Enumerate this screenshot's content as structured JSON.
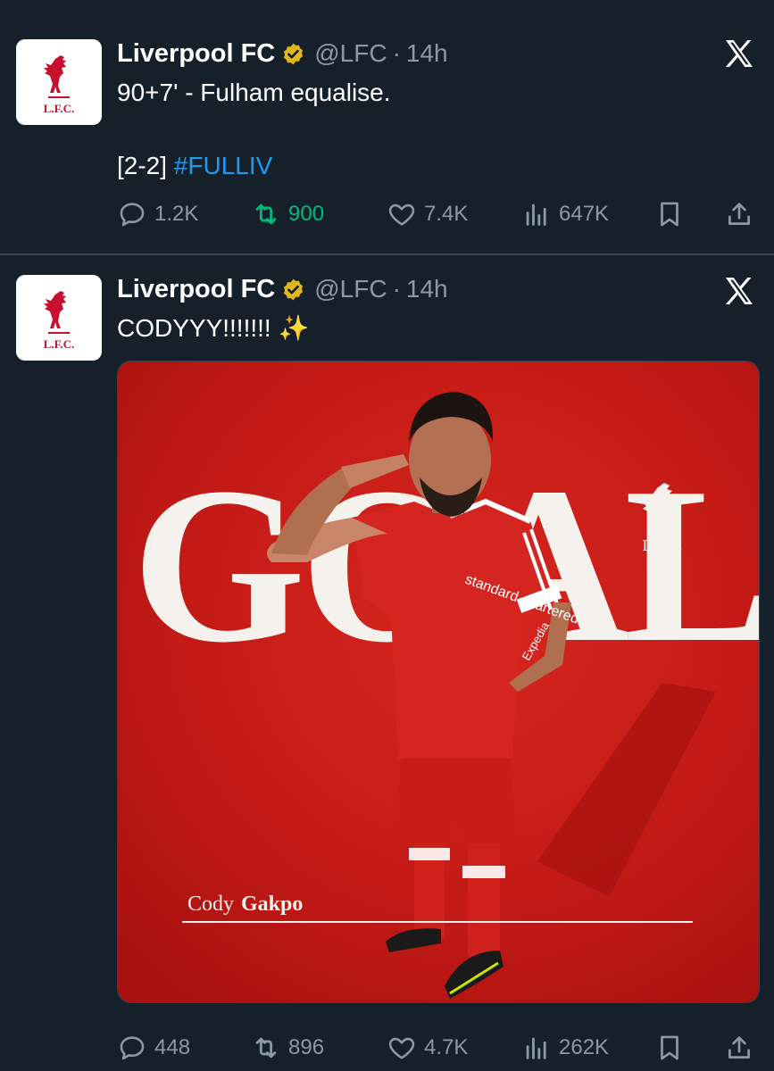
{
  "tweets": [
    {
      "author": "Liverpool FC",
      "handle": "@LFC",
      "dot": "·",
      "time": "14h",
      "text_line1": "90+7' - Fulham equalise.",
      "text_line2_prefix": "[2-2] ",
      "hashtag": "#FULLIV",
      "replies": "1.2K",
      "retweets": "900",
      "likes": "7.4K",
      "views": "647K",
      "retweeted": true
    },
    {
      "author": "Liverpool FC",
      "handle": "@LFC",
      "dot": "·",
      "time": "14h",
      "text": "CODYYY!!!!!!! ✨",
      "media": {
        "headline": "GOAL",
        "player_first": "Cody",
        "player_last": "Gakpo",
        "crest_text": "L.F.C.",
        "shirt_sponsor": "standard chartered",
        "sleeve_sponsor": "Expedia"
      },
      "replies": "448",
      "retweets": "896",
      "likes": "4.7K",
      "views": "262K"
    }
  ],
  "avatar_text": "L.F.C.",
  "colors": {
    "background": "#15202b",
    "muted": "#8b98a5",
    "link": "#1d9bf0",
    "retweet_active": "#00ba7c",
    "verified_gold": "#e2b719",
    "lfc_red": "#c8102e"
  }
}
